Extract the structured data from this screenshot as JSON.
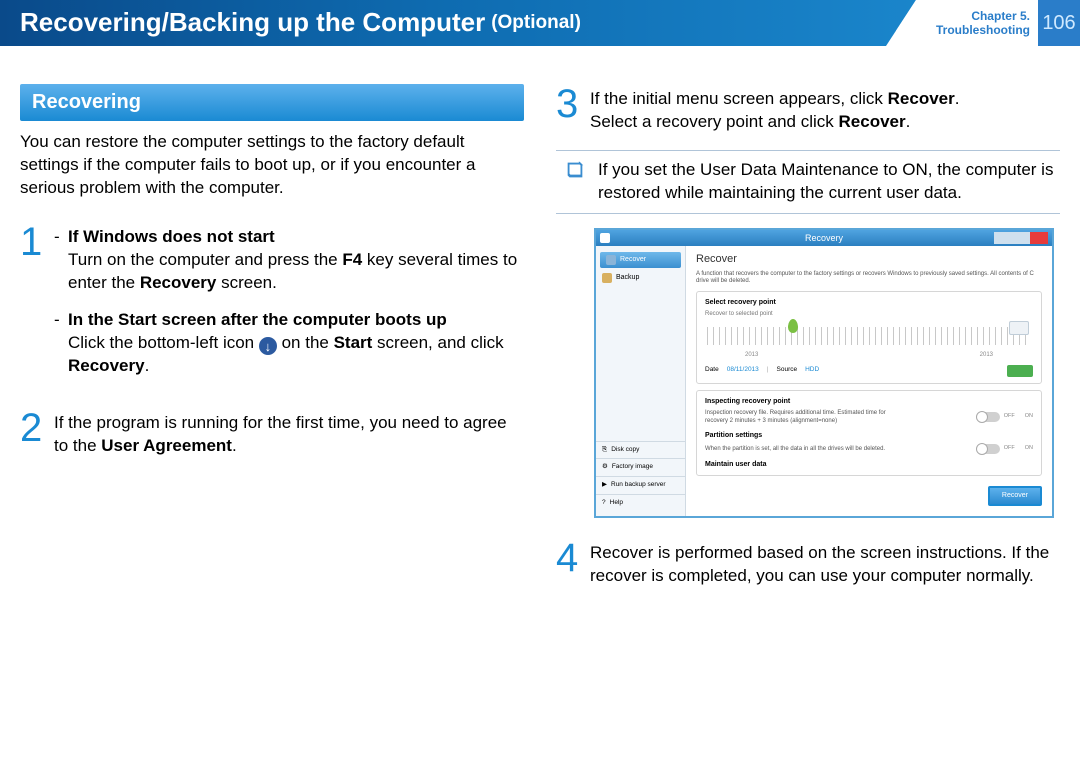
{
  "header": {
    "title": "Recovering/Backing up the Computer",
    "paren": "(Optional)",
    "chapter_line1": "Chapter 5.",
    "chapter_line2": "Troubleshooting",
    "page": "106"
  },
  "section": {
    "title": "Recovering"
  },
  "intro": "You can restore the computer settings to the factory default settings if the computer fails to boot up, or if you encounter a serious problem with the computer.",
  "steps": {
    "s1": {
      "num": "1",
      "a_title": "If Windows does not start",
      "a_body1": "Turn on the computer and press the ",
      "a_key": "F4",
      "a_body2": " key several times to enter the ",
      "a_bold": "Recovery",
      "a_body3": " screen.",
      "b_title": "In the Start screen after the computer boots up",
      "b_body1": "Click the bottom-left icon ",
      "b_body2": " on the ",
      "b_bold1": "Start",
      "b_body3": " screen, and click ",
      "b_bold2": "Recovery",
      "b_body4": "."
    },
    "s2": {
      "num": "2",
      "body1": "If the program is running for the first time, you need to agree to the ",
      "bold": "User Agreement",
      "body2": "."
    },
    "s3": {
      "num": "3",
      "line1a": "If the initial menu screen appears, click ",
      "line1b": "Recover",
      "line1c": ".",
      "line2a": "Select a recovery point and click ",
      "line2b": "Recover",
      "line2c": "."
    },
    "s4": {
      "num": "4",
      "body": "Recover is performed based on the screen instructions. If the recover is completed, you can use your computer normally."
    }
  },
  "note": "If you set the User Data Maintenance to ON, the computer is restored while maintaining the current user data.",
  "shot": {
    "title": "Recovery",
    "side": {
      "recover": "Recover",
      "backup": "Backup",
      "disk_copy": "Disk copy",
      "factory": "Factory image",
      "run": "Run backup server",
      "help": "Help"
    },
    "main": {
      "h": "Recover",
      "desc": "A function that recovers the computer to the factory settings or recovers Windows to previously saved settings. All contents of C drive will be deleted.",
      "p1_h": "Select recovery point",
      "p1_sub": "Recover to selected point",
      "year1": "2013",
      "year2": "2013",
      "date_lbl": "Date",
      "date_val": "08/11/2013",
      "src_lbl": "Source",
      "src_val": "HDD",
      "p2_h": "Inspecting recovery point",
      "p2_t": "Inspection recovery file. Requires additional time. Estimated time for recovery 2 minutes + 3 minutes (alignment=none)",
      "p3_h": "Partition settings",
      "p3_t": "When the partition is set, all the data in all the drives will be deleted.",
      "p4_h": "Maintain user data",
      "off": "OFF",
      "on": "ON",
      "btn": "Recover"
    }
  }
}
